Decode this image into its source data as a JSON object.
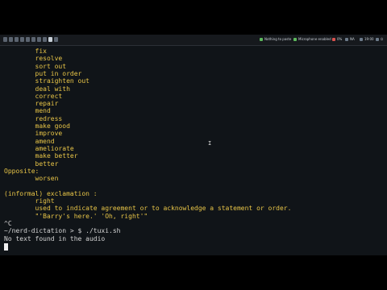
{
  "topbar": {
    "tray": [
      {
        "label": "Nothing to paste",
        "icon": "clipboard-icon",
        "color": "#5cb85c"
      },
      {
        "label": "Microphone enabled",
        "icon": "microphone-icon",
        "color": "#5cb85c"
      },
      {
        "label": "0%",
        "icon": "battery-icon",
        "color": "#d9534f"
      },
      {
        "label": "NA",
        "icon": "volume-icon",
        "color": "#6c7a89"
      },
      {
        "label": "19:00",
        "icon": "clock-icon",
        "color": "#6c7a89"
      },
      {
        "label": "⏻",
        "icon": "power-icon",
        "color": "#6c7a89"
      }
    ]
  },
  "terminal": {
    "lines": [
      {
        "text": "        fix",
        "tone": "yellow"
      },
      {
        "text": "        resolve",
        "tone": "yellow"
      },
      {
        "text": "        sort out",
        "tone": "yellow"
      },
      {
        "text": "        put in order",
        "tone": "yellow"
      },
      {
        "text": "        straighten out",
        "tone": "yellow"
      },
      {
        "text": "        deal with",
        "tone": "yellow"
      },
      {
        "text": "        correct",
        "tone": "yellow"
      },
      {
        "text": "        repair",
        "tone": "yellow"
      },
      {
        "text": "        mend",
        "tone": "yellow"
      },
      {
        "text": "        redress",
        "tone": "yellow"
      },
      {
        "text": "        make good",
        "tone": "yellow"
      },
      {
        "text": "        improve",
        "tone": "yellow"
      },
      {
        "text": "        amend",
        "tone": "yellow"
      },
      {
        "text": "        ameliorate",
        "tone": "yellow"
      },
      {
        "text": "        make better",
        "tone": "yellow"
      },
      {
        "text": "        better",
        "tone": "yellow"
      },
      {
        "text": "Opposite:",
        "tone": "yellow"
      },
      {
        "text": "        worsen",
        "tone": "yellow"
      },
      {
        "text": "",
        "tone": "yellow"
      },
      {
        "text": "(informal) exclamation :",
        "tone": "yellow"
      },
      {
        "text": "        right",
        "tone": "yellow"
      },
      {
        "text": "        used to indicate agreement or to acknowledge a statement or order.",
        "tone": "yellow"
      },
      {
        "text": "        \"'Barry's here.' 'Oh, right'\"",
        "tone": "yellow"
      },
      {
        "text": "^C",
        "tone": "white"
      },
      {
        "text": "~/nerd-dictation > $ ./tuxi.sh",
        "tone": "white"
      },
      {
        "text": "No text found in the audio",
        "tone": "white"
      }
    ]
  }
}
